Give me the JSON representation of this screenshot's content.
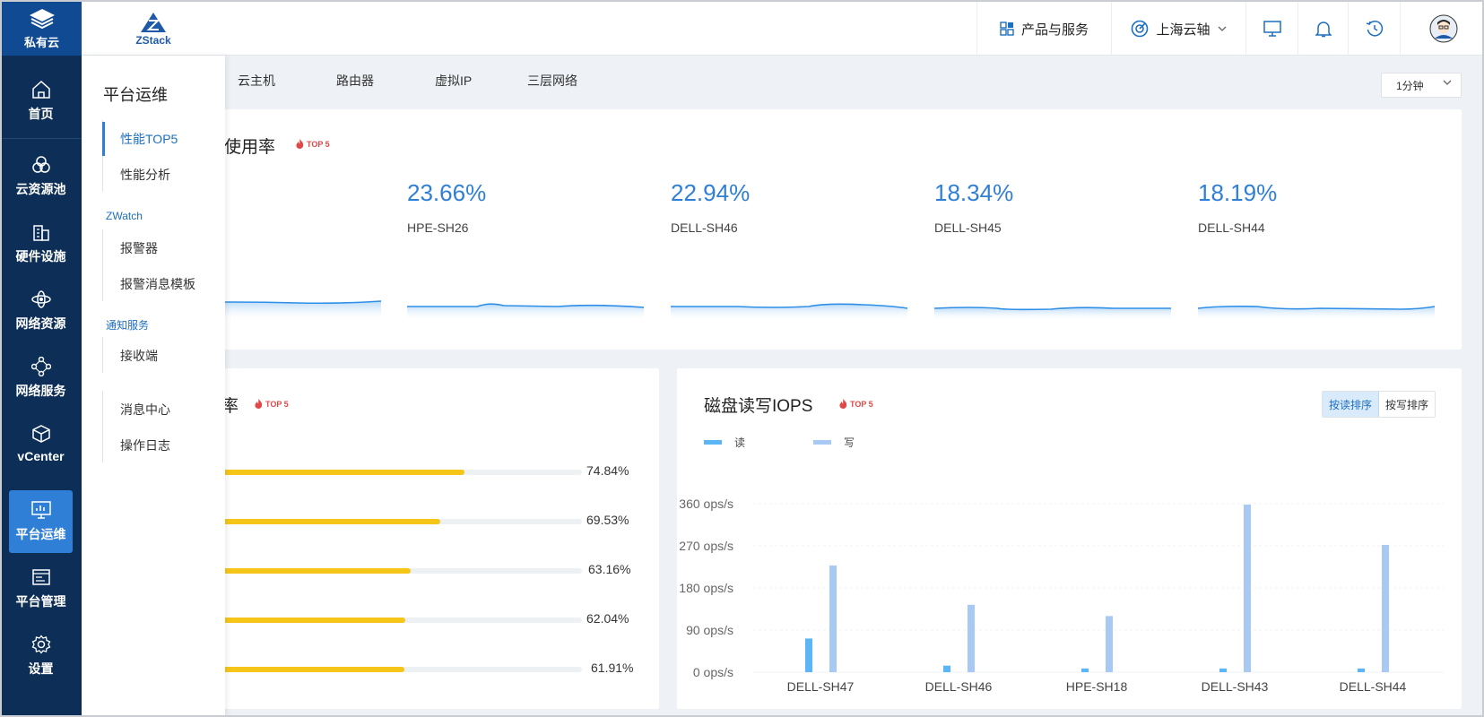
{
  "nav": {
    "logo_label": "私有云",
    "items": [
      {
        "label": "首页",
        "icon": "home-icon"
      },
      {
        "label": "云资源池",
        "icon": "resource-pool-icon"
      },
      {
        "label": "硬件设施",
        "icon": "building-icon"
      },
      {
        "label": "网络资源",
        "icon": "network-resource-icon"
      },
      {
        "label": "网络服务",
        "icon": "network-service-icon"
      },
      {
        "label": "vCenter",
        "icon": "cube-icon"
      },
      {
        "label": "平台运维",
        "icon": "monitor-chart-icon",
        "active": true
      },
      {
        "label": "平台管理",
        "icon": "window-list-icon"
      },
      {
        "label": "设置",
        "icon": "gear-icon"
      }
    ]
  },
  "topbar": {
    "brand_name": "ZStack",
    "products_label": "产品与服务",
    "region_label": "上海云轴"
  },
  "subpanel": {
    "title": "平台运维",
    "items": [
      "性能TOP5",
      "性能分析"
    ],
    "group_zwatch": "ZWatch",
    "zwatch_items": [
      "报警器",
      "报警消息模板"
    ],
    "group_notify": "通知服务",
    "notify_items": [
      "接收端"
    ],
    "other_items": [
      "消息中心",
      "操作日志"
    ]
  },
  "tabs": [
    "云主机",
    "路由器",
    "虚拟IP",
    "三层网络"
  ],
  "interval_select": "1分钟",
  "top5_badge": "TOP 5",
  "cpu_card": {
    "title_visible": "使用率",
    "metrics": [
      {
        "value": "23.66%",
        "name": "HPE-SH26"
      },
      {
        "value": "22.94%",
        "name": "DELL-SH46"
      },
      {
        "value": "18.34%",
        "name": "DELL-SH45"
      },
      {
        "value": "18.19%",
        "name": "DELL-SH44"
      }
    ]
  },
  "mem_card": {
    "title_visible": "率",
    "bars": [
      {
        "pct_label": "74.84%",
        "value": 74.84
      },
      {
        "pct_label": "69.53%",
        "value": 69.53
      },
      {
        "pct_label": "63.16%",
        "value": 63.16
      },
      {
        "pct_label": "62.04%",
        "value": 62.04
      },
      {
        "pct_label": "61.91%",
        "value": 61.91
      }
    ]
  },
  "iops_card": {
    "title": "磁盘读写IOPS",
    "sort_read": "按读排序",
    "sort_write": "按写排序",
    "legend_read": "读",
    "legend_write": "写"
  },
  "colors": {
    "nav_bg": "#0d2f57",
    "accent": "#2f7fd6",
    "bar_yellow": "#f5c518",
    "read_bar": "#5cb6f5",
    "write_bar": "#a9c9f5"
  },
  "chart_data": {
    "type": "bar",
    "title": "磁盘读写IOPS",
    "categories": [
      "DELL-SH47",
      "DELL-SH46",
      "HPE-SH18",
      "DELL-SH43",
      "DELL-SH44"
    ],
    "series": [
      {
        "name": "读",
        "values": [
          72,
          14,
          8,
          8,
          8
        ]
      },
      {
        "name": "写",
        "values": [
          228,
          144,
          120,
          358,
          272
        ]
      }
    ],
    "yticks": [
      "0 ops/s",
      "90 ops/s",
      "180 ops/s",
      "270 ops/s",
      "360 ops/s"
    ],
    "ylim": [
      0,
      360
    ],
    "grid": true,
    "legend": "top-left"
  }
}
